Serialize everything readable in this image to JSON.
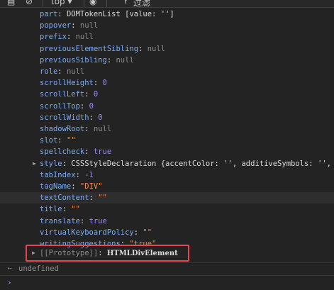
{
  "toolbar": {
    "sidebar_icon": "▤",
    "clear_icon": "⊘",
    "context_label": "top ▾",
    "eye_icon": "◉",
    "filter_icon": "Y",
    "filter_label": "过滤"
  },
  "properties": [
    {
      "key": "part",
      "value": "DOMTokenList  [value: '']",
      "type": "plain"
    },
    {
      "key": "popover",
      "value": "null",
      "type": "nul"
    },
    {
      "key": "prefix",
      "value": "null",
      "type": "nul"
    },
    {
      "key": "previousElementSibling",
      "value": "null",
      "type": "nul"
    },
    {
      "key": "previousSibling",
      "value": "null",
      "type": "nul"
    },
    {
      "key": "role",
      "value": "null",
      "type": "nul"
    },
    {
      "key": "scrollHeight",
      "value": "0",
      "type": "num"
    },
    {
      "key": "scrollLeft",
      "value": "0",
      "type": "num"
    },
    {
      "key": "scrollTop",
      "value": "0",
      "type": "num"
    },
    {
      "key": "scrollWidth",
      "value": "0",
      "type": "num"
    },
    {
      "key": "shadowRoot",
      "value": "null",
      "type": "nul"
    },
    {
      "key": "slot",
      "value": "\"\"",
      "type": "str"
    },
    {
      "key": "spellcheck",
      "value": "true",
      "type": "kw"
    },
    {
      "key": "style",
      "value": "CSSStyleDeclaration  {accentColor: '', additiveSymbols: '', al",
      "type": "plain",
      "expandable": true
    },
    {
      "key": "tabIndex",
      "value": "-1",
      "type": "num"
    },
    {
      "key": "tagName",
      "value": "\"DIV\"",
      "type": "str"
    },
    {
      "key": "textContent",
      "value": "\"\"",
      "type": "str",
      "highlight": true
    },
    {
      "key": "title",
      "value": "\"\"",
      "type": "str"
    },
    {
      "key": "translate",
      "value": "true",
      "type": "kw"
    },
    {
      "key": "virtualKeyboardPolicy",
      "value": "\"\"",
      "type": "str"
    },
    {
      "key": "writingSuggestions",
      "value": "\"true\"",
      "type": "str"
    }
  ],
  "prototype": {
    "key": "[[Prototype]]",
    "value": "HTMLDivElement"
  },
  "result": {
    "text": "undefined",
    "return_icon": "⇠"
  },
  "prompt": {
    "icon": "›"
  },
  "colors": {
    "key": "#7cacf8",
    "number": "#9f86ff",
    "null": "#8c8c8c",
    "string": "#f28b54",
    "highlight_box": "#e5484d"
  }
}
